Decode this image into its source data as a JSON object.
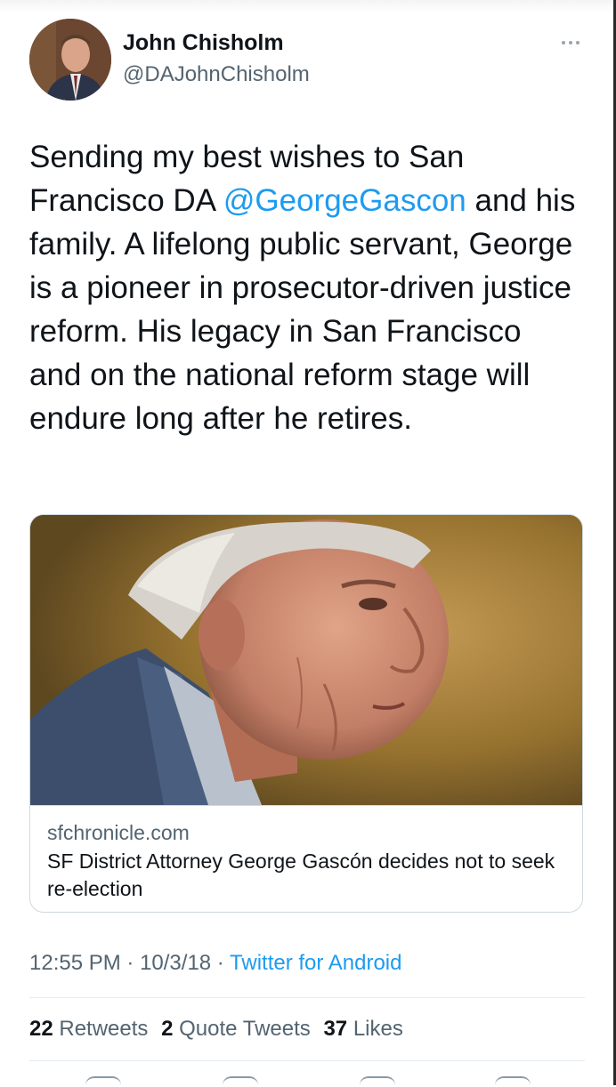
{
  "author": {
    "name": "John Chisholm",
    "handle": "@DAJohnChisholm"
  },
  "tweet": {
    "text_before_mention": "Sending my best wishes to San Francisco DA ",
    "mention": "@GeorgeGascon",
    "text_after_mention": " and his family. A lifelong public servant, George is a pioneer in prosecutor-driven justice reform. His legacy in San Francisco and on the national reform stage will endure long after he retires."
  },
  "card": {
    "domain": "sfchronicle.com",
    "title": "SF District Attorney George Gascón decides not to seek re-election"
  },
  "meta": {
    "time": "12:55 PM",
    "separator": " · ",
    "date": "10/3/18",
    "source": "Twitter for Android"
  },
  "stats": {
    "retweets_count": "22",
    "retweets_label": "Retweets",
    "quotes_count": "2",
    "quotes_label": "Quote Tweets",
    "likes_count": "37",
    "likes_label": "Likes"
  },
  "icons": {
    "more": "more-horizontal-icon",
    "reply": "reply-icon",
    "retweet": "retweet-icon",
    "like": "like-icon",
    "share": "share-icon"
  },
  "colors": {
    "link": "#1d9bf0",
    "secondary_text": "#536471",
    "primary_text": "#0f1419",
    "border": "#cfd9de"
  }
}
